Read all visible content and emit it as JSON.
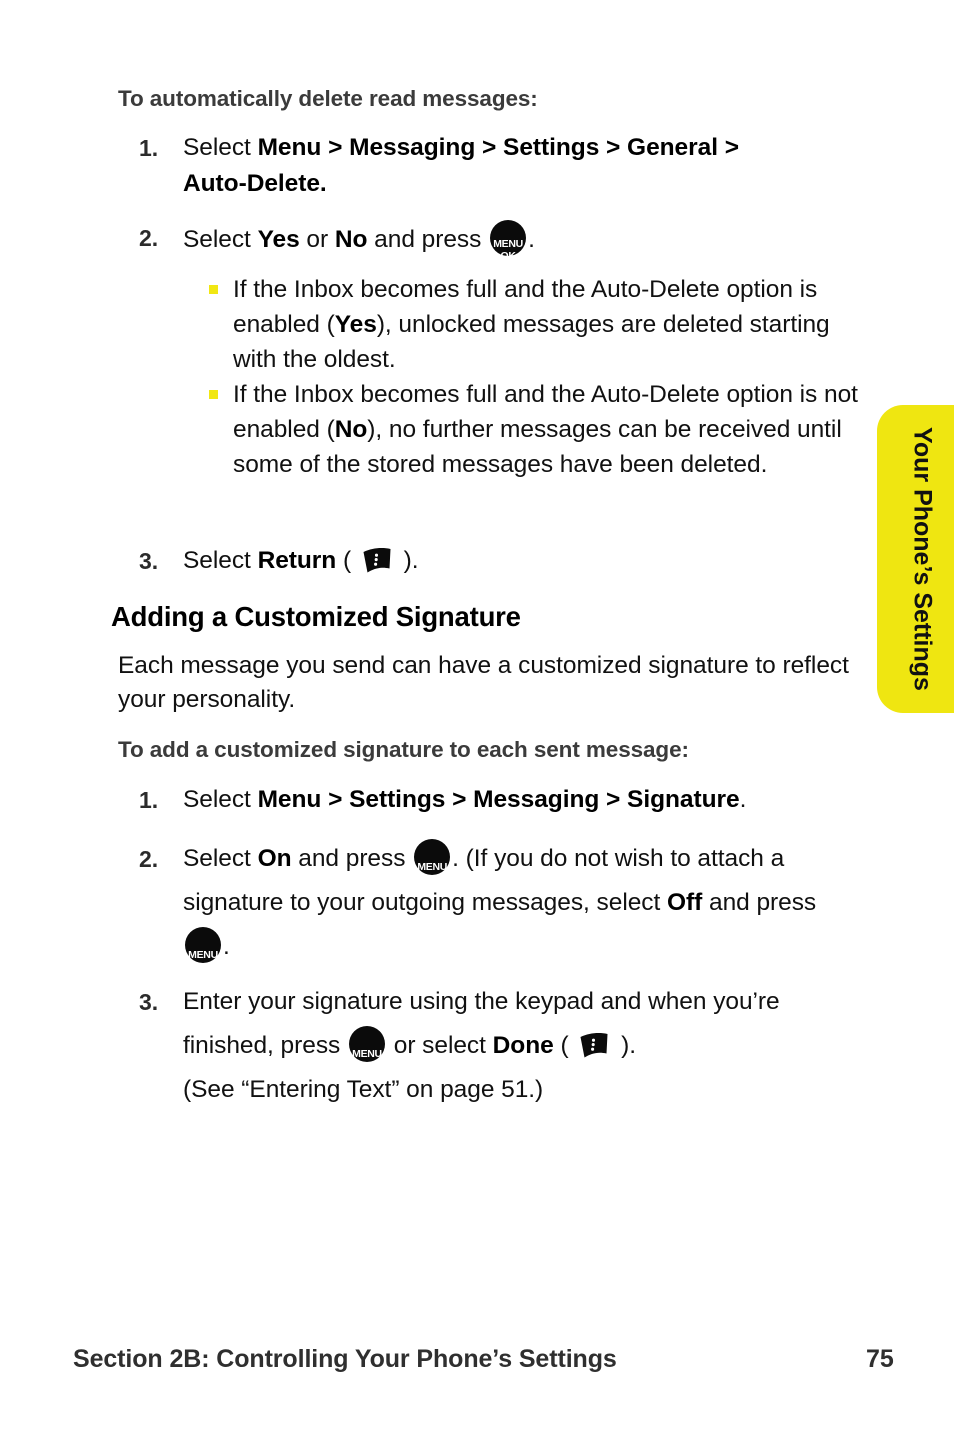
{
  "page": {
    "number": "75",
    "footer_section": "Section 2B: Controlling Your Phone’s Settings",
    "side_tab_label": "Your Phone’s Settings",
    "accent_yellow": "#EFE611",
    "bullet_yellow": "#F1E713",
    "heading_gray": "#3b3b3b"
  },
  "icons": {
    "menu_ok_line1": "MENU",
    "menu_ok_line2": "OK",
    "menu_ok_name": "menu-ok-key-icon",
    "softkey_name": "softkey-icon"
  },
  "section_auto_delete": {
    "subhead": "To automatically delete read messages:",
    "steps": [
      {
        "num": "1.",
        "html": "Select <b>Menu &gt; Messaging &gt; Settings &gt; General &gt; Auto-Delete.</b>",
        "text": "Select Menu > Messaging > Settings > General > Auto-Delete."
      },
      {
        "num": "2.",
        "html": "Select <b>Yes</b> or <b>No</b> and press [MENUOK].",
        "text": "Select Yes or No and press MENU OK ."
      },
      {
        "num": "3.",
        "html": "Select <b>Return</b> ( [SOFTKEY] ).",
        "text": "Select Return ( softkey )."
      }
    ],
    "bullets": [
      {
        "html": "If the Inbox becomes full and the Auto-Delete option is enabled (<b>Yes</b>), unlocked messages are deleted starting with the oldest.",
        "text": "If the Inbox becomes full and the Auto-Delete option is enabled (Yes), unlocked messages are deleted starting with the oldest."
      },
      {
        "html": "If the Inbox becomes full and the Auto-Delete option is not enabled (<b>No</b>), no further messages can be received until some of the stored messages have been deleted.",
        "text": "If the Inbox becomes full and the Auto-Delete option is not enabled (No), no further messages can be received until some of the stored messages have been deleted."
      }
    ]
  },
  "section_signature": {
    "heading": "Adding a Customized Signature",
    "intro": "Each message you send can have a customized signature to reflect your personality.",
    "subhead": "To add a customized signature to each sent message:",
    "steps": [
      {
        "num": "1.",
        "html": "Select <b>Menu &gt; Settings &gt; Messaging &gt; Signature</b>.",
        "text": "Select Menu > Settings > Messaging > Signature."
      },
      {
        "num": "2.",
        "html": "Select <b>On</b> and press [MENUOK]. (If you do not wish to attach a signature to your outgoing messages, select <b>Off</b> and press [MENUOK].",
        "text": "Select On and press MENU OK . (If you do not wish to attach a signature to your outgoing messages, select Off and press MENU OK ."
      },
      {
        "num": "3.",
        "html": "Enter your signature using the keypad and when you’re finished, press [MENUOK] or select <b>Done</b> ( [SOFTKEY] ).<br>(See “Entering Text” on page 51.)",
        "text": "Enter your signature using the keypad and when you’re finished, press MENU OK or select Done ( softkey ). (See “Entering Text” on page 51.)"
      }
    ]
  }
}
